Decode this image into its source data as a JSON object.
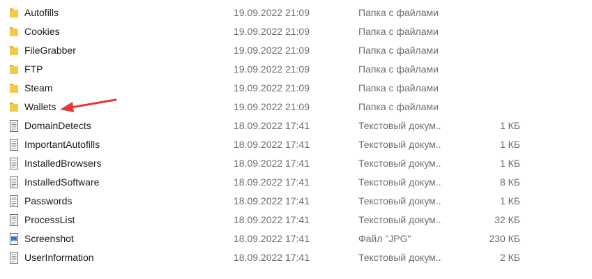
{
  "files": [
    {
      "name": "Autofills",
      "date": "19.09.2022 21:09",
      "type": "Папка с файлами",
      "size": "",
      "icon": "folder-icon"
    },
    {
      "name": "Cookies",
      "date": "19.09.2022 21:09",
      "type": "Папка с файлами",
      "size": "",
      "icon": "folder-icon"
    },
    {
      "name": "FileGrabber",
      "date": "19.09.2022 21:09",
      "type": "Папка с файлами",
      "size": "",
      "icon": "folder-icon"
    },
    {
      "name": "FTP",
      "date": "19.09.2022 21:09",
      "type": "Папка с файлами",
      "size": "",
      "icon": "folder-icon"
    },
    {
      "name": "Steam",
      "date": "19.09.2022 21:09",
      "type": "Папка с файлами",
      "size": "",
      "icon": "folder-icon"
    },
    {
      "name": "Wallets",
      "date": "19.09.2022 21:09",
      "type": "Папка с файлами",
      "size": "",
      "icon": "folder-icon"
    },
    {
      "name": "DomainDetects",
      "date": "18.09.2022 17:41",
      "type": "Текстовый докум...",
      "size": "1 КБ",
      "icon": "text-file-icon"
    },
    {
      "name": "ImportantAutofills",
      "date": "18.09.2022 17:41",
      "type": "Текстовый докум...",
      "size": "1 КБ",
      "icon": "text-file-icon"
    },
    {
      "name": "InstalledBrowsers",
      "date": "18.09.2022 17:41",
      "type": "Текстовый докум...",
      "size": "1 КБ",
      "icon": "text-file-icon"
    },
    {
      "name": "InstalledSoftware",
      "date": "18.09.2022 17:41",
      "type": "Текстовый докум...",
      "size": "8 КБ",
      "icon": "text-file-icon"
    },
    {
      "name": "Passwords",
      "date": "18.09.2022 17:41",
      "type": "Текстовый докум...",
      "size": "1 КБ",
      "icon": "text-file-icon"
    },
    {
      "name": "ProcessList",
      "date": "18.09.2022 17:41",
      "type": "Текстовый докум...",
      "size": "32 КБ",
      "icon": "text-file-icon"
    },
    {
      "name": "Screenshot",
      "date": "18.09.2022 17:41",
      "type": "Файл \"JPG\"",
      "size": "230 КБ",
      "icon": "image-file-icon"
    },
    {
      "name": "UserInformation",
      "date": "18.09.2022 17:41",
      "type": "Текстовый докум...",
      "size": "2 КБ",
      "icon": "text-file-icon"
    }
  ],
  "colors": {
    "folder": "#f7c948",
    "folder_dark": "#e3a92a",
    "arrow": "#e53935",
    "secondary_text": "#6d6d6d"
  }
}
